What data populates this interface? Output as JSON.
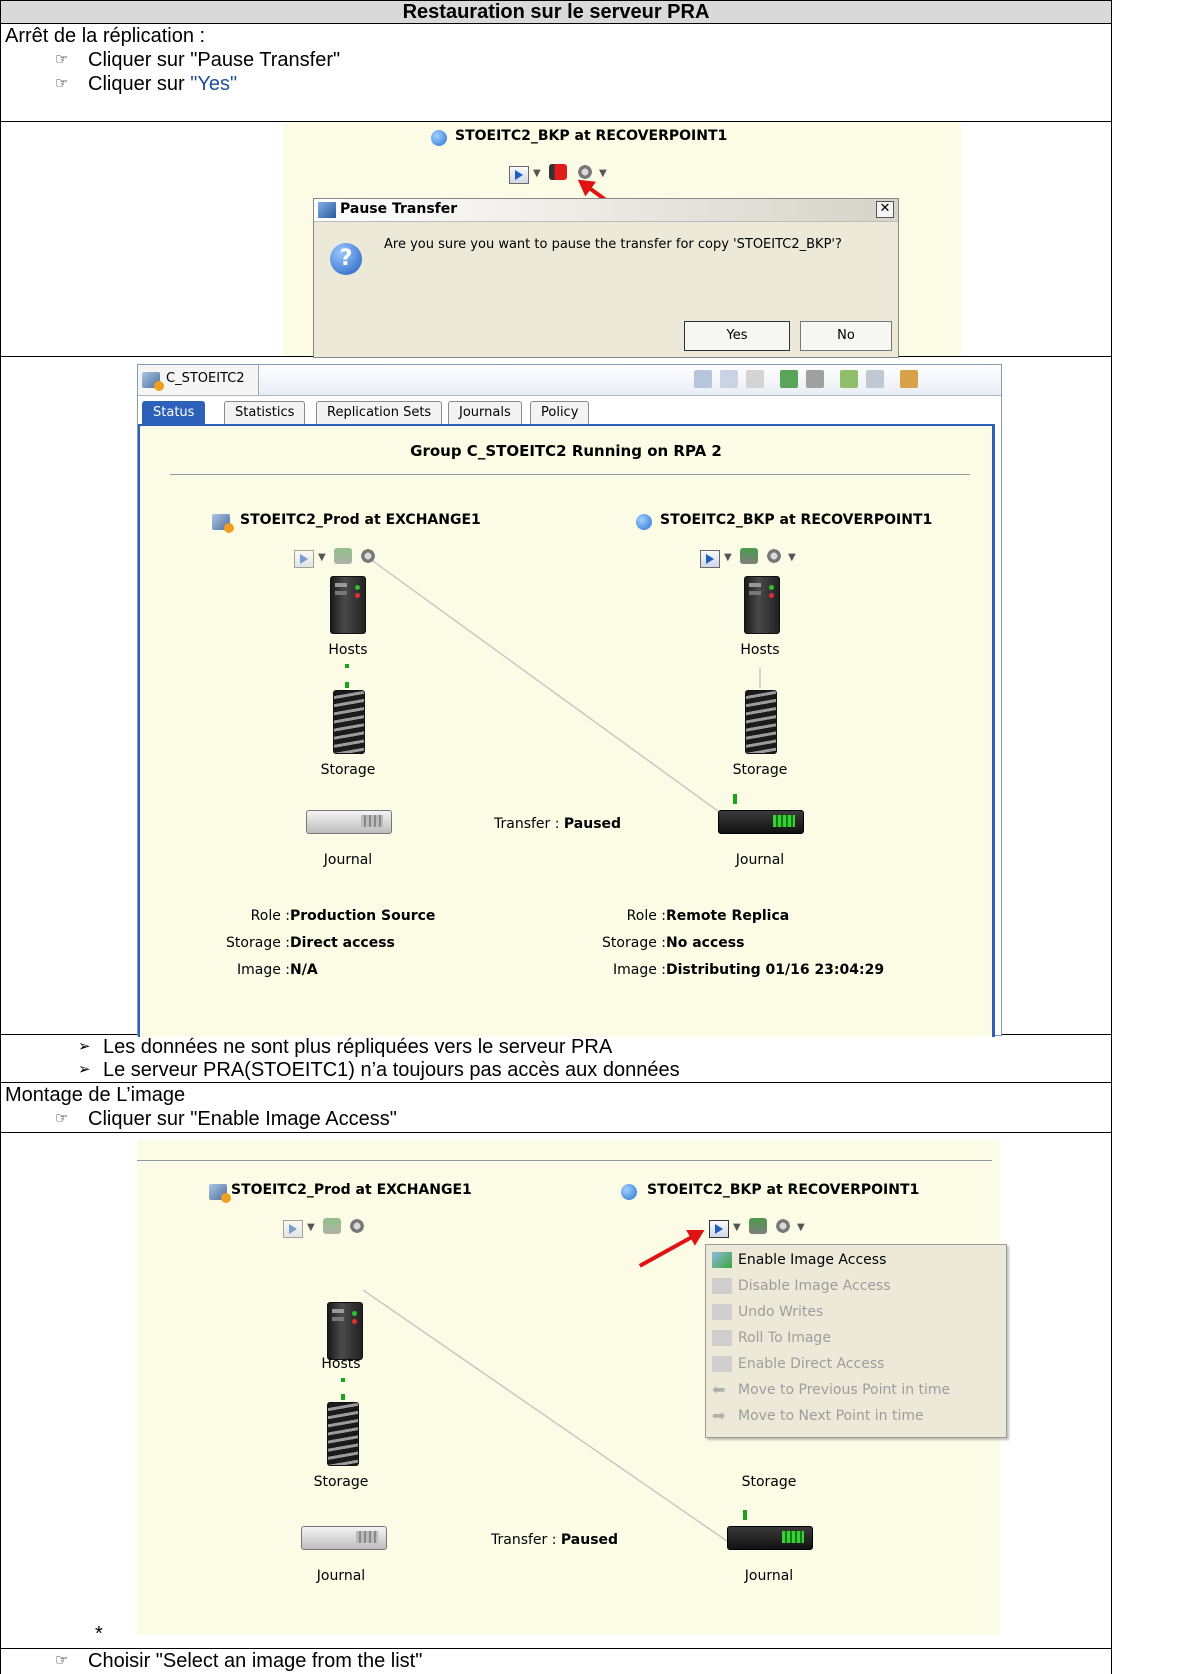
{
  "header": {
    "title": "Restauration sur le serveur PRA"
  },
  "section1": {
    "intro": "Arrêt de la réplication :",
    "step1": "Cliquer sur \"Pause Transfer\"",
    "step2_prefix": "Cliquer sur ",
    "step2_link": "\"Yes\""
  },
  "shot1": {
    "copy_title": "STOEITC2_BKP at RECOVERPOINT1",
    "dialog_title": "Pause Transfer",
    "dialog_text": "Are you sure you want to pause the transfer for copy 'STOEITC2_BKP'?",
    "yes": "Yes",
    "no": "No"
  },
  "shot2": {
    "window_title": "C_STOEITC2",
    "tabs": [
      "Status",
      "Statistics",
      "Replication Sets",
      "Journals",
      "Policy"
    ],
    "group_title": "Group C_STOEITC2 Running on  RPA 2",
    "left_title": "STOEITC2_Prod at EXCHANGE1",
    "right_title": "STOEITC2_BKP at RECOVERPOINT1",
    "hosts": "Hosts",
    "storage": "Storage",
    "journal": "Journal",
    "transfer_label": "Transfer : ",
    "transfer_value": "Paused",
    "left_info": [
      {
        "k": "Role : ",
        "v": "Production Source"
      },
      {
        "k": "Storage : ",
        "v": "Direct access"
      },
      {
        "k": "Image : ",
        "v": "N/A"
      }
    ],
    "right_info": [
      {
        "k": "Role : ",
        "v": "Remote Replica"
      },
      {
        "k": "Storage : ",
        "v": "No access"
      },
      {
        "k": "Image : ",
        "v": "Distributing 01/16 23:04:29"
      }
    ]
  },
  "notes": [
    "Les données ne sont plus répliquées vers le serveur PRA",
    "Le serveur PRA(STOEITC1) n’a toujours pas accès aux données"
  ],
  "section2": {
    "intro": "Montage de L’image",
    "step1": "Cliquer sur \"Enable Image Access\""
  },
  "shot3": {
    "left_title": "STOEITC2_Prod at EXCHANGE1",
    "right_title": "STOEITC2_BKP at RECOVERPOINT1",
    "hosts": "Hosts",
    "storage": "Storage",
    "journal": "Journal",
    "transfer_label": "Transfer : ",
    "transfer_value": "Paused",
    "menu": [
      "Enable Image Access",
      "Disable Image Access",
      "Undo Writes",
      "Roll To Image",
      "Enable Direct Access",
      "Move to Previous Point in time",
      "Move to Next Point in time"
    ],
    "asterisk": "*"
  },
  "section3": {
    "step1": "Choisir \"Select an image from the list\""
  }
}
